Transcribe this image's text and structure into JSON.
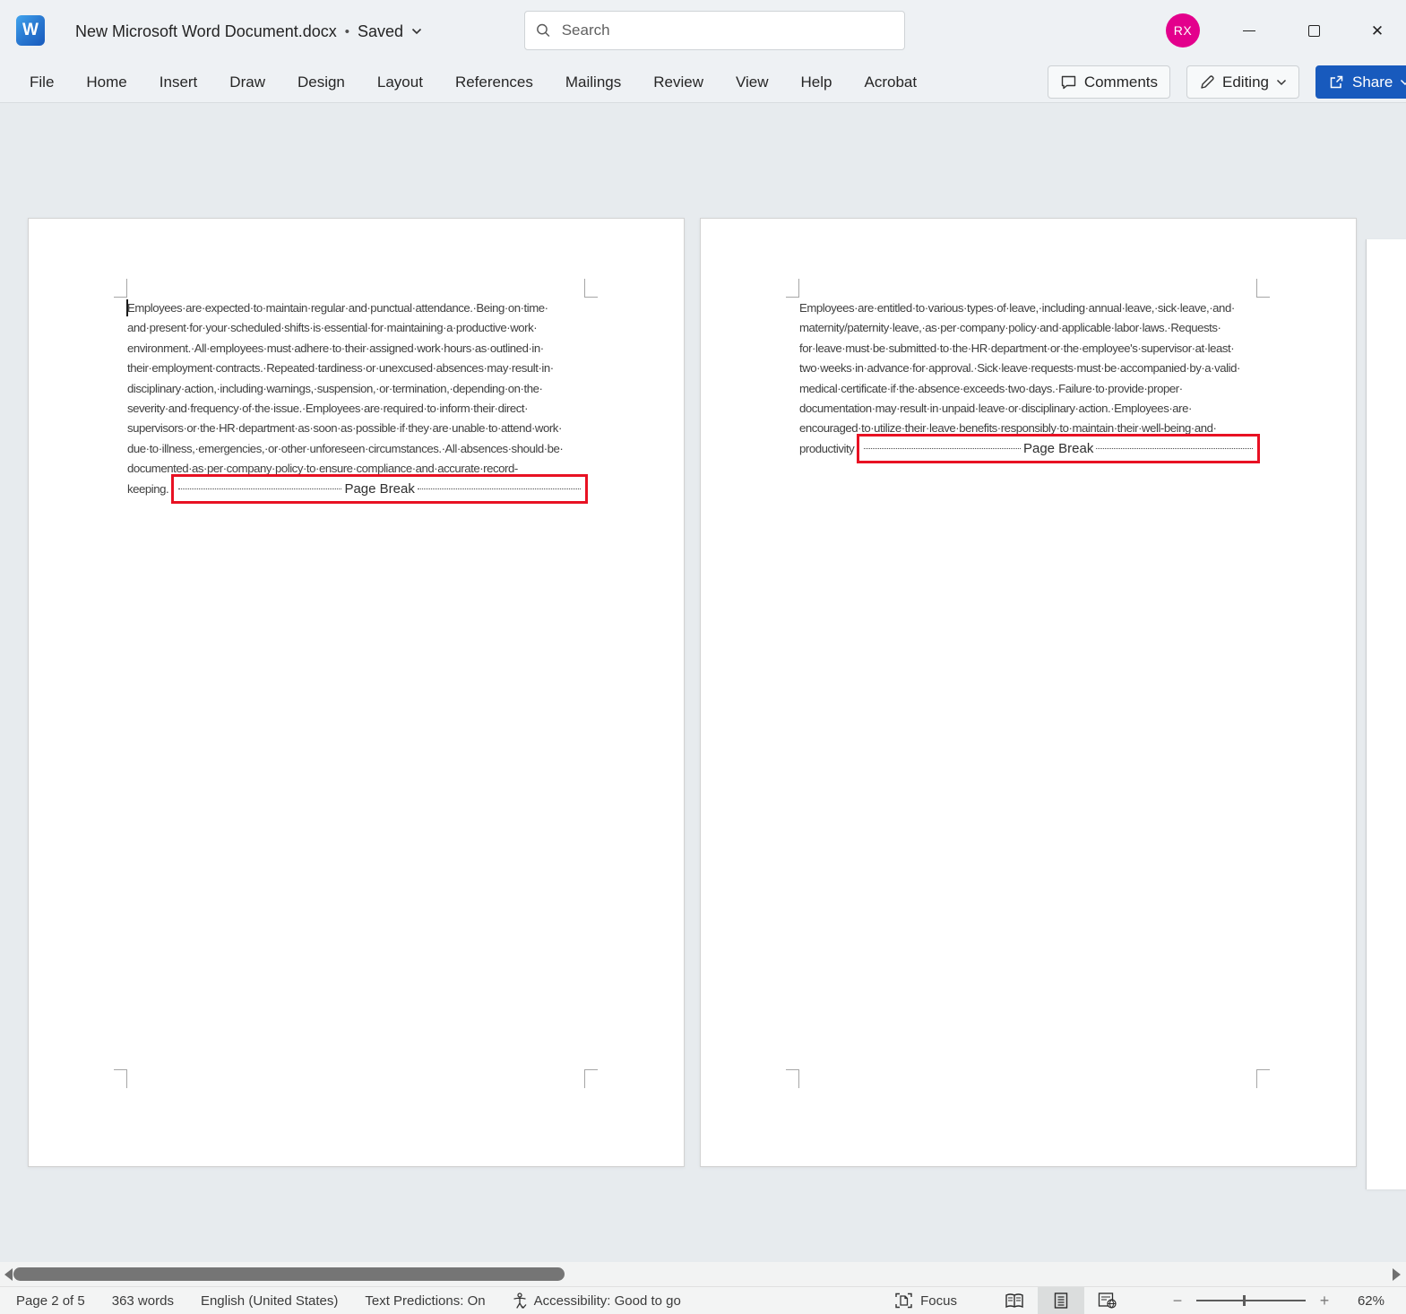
{
  "titlebar": {
    "app_letter": "W",
    "document_title": "New Microsoft Word Document.docx",
    "separator": "•",
    "save_status": "Saved",
    "search_placeholder": "Search",
    "avatar_initials": "RX",
    "close_glyph": "✕"
  },
  "ribbon": {
    "tabs": [
      "File",
      "Home",
      "Insert",
      "Draw",
      "Design",
      "Layout",
      "References",
      "Mailings",
      "Review",
      "View",
      "Help",
      "Acrobat"
    ],
    "comments_label": "Comments",
    "editing_label": "Editing",
    "share_label": "Share"
  },
  "document": {
    "space_mark": "·",
    "pages": [
      {
        "lines": [
          "Employees are expected to maintain regular and punctual attendance. Being on time",
          "and present for your scheduled shifts is essential for maintaining a productive work",
          "environment. All employees must adhere to their assigned work hours as outlined in",
          "their employment contracts. Repeated tardiness or unexcused absences may result in",
          "disciplinary action, including warnings, suspension, or termination, depending on the",
          "severity and frequency of the issue. Employees are required to inform their direct",
          "supervisors or the HR department as soon as possible if they are unable to attend work",
          "due to illness, emergencies, or other unforeseen circumstances. All absences should be",
          "documented as per company policy to ensure compliance and accurate record-"
        ],
        "last_word": "keeping.",
        "page_break_label": "Page Break"
      },
      {
        "lines": [
          "Employees are entitled to various types of leave, including annual leave, sick leave, and",
          "maternity/paternity leave, as per company policy and applicable labor laws. Requests",
          "for leave must be submitted to the HR department or the employee's supervisor at least",
          "two weeks in advance for approval. Sick leave requests must be accompanied by a valid",
          "medical certificate if the absence exceeds two days. Failure to provide proper",
          "documentation may result in unpaid leave or disciplinary action. Employees are",
          "encouraged to utilize their leave benefits responsibly to maintain their well-being and"
        ],
        "last_word": "productivity",
        "page_break_label": "Page Break"
      }
    ]
  },
  "status_bar": {
    "page_indicator": "Page 2 of 5",
    "word_count": "363 words",
    "language": "English (United States)",
    "text_predictions": "Text Predictions: On",
    "accessibility": "Accessibility: Good to go",
    "focus_label": "Focus",
    "zoom_level": "62%"
  },
  "colors": {
    "share_blue": "#185abd",
    "avatar_magenta": "#e3008c",
    "page_break_highlight_red": "#e81123"
  }
}
